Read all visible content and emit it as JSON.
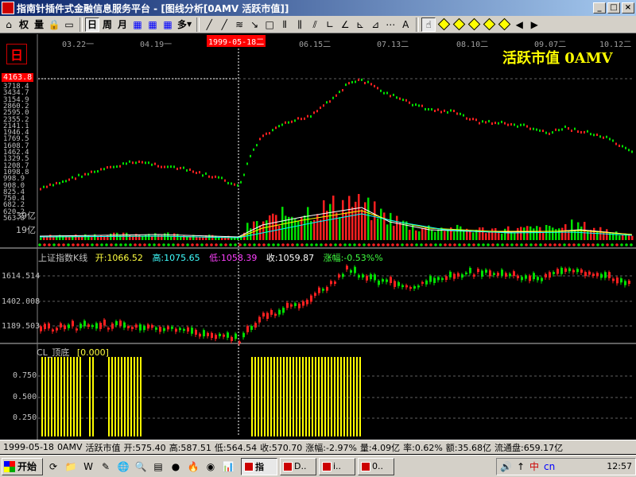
{
  "window": {
    "title": "指南针插件式金融信息服务平台 - [图线分析[0AMV 活跃市值]]",
    "buttons": [
      "_",
      "□",
      "×"
    ]
  },
  "toolbar": {
    "items": [
      {
        "id": "refresh",
        "label": "",
        "icon": "⌂"
      },
      {
        "id": "quan",
        "label": "权",
        "icon": ""
      },
      {
        "id": "liang",
        "label": "量",
        "icon": ""
      },
      {
        "id": "lock",
        "label": "",
        "icon": "🔒"
      },
      {
        "id": "window",
        "label": "",
        "icon": "▭"
      },
      {
        "id": "day",
        "label": "日",
        "icon": ""
      },
      {
        "id": "week",
        "label": "周",
        "icon": ""
      },
      {
        "id": "month",
        "label": "月",
        "icon": ""
      },
      {
        "id": "multi",
        "label": "多",
        "icon": ""
      }
    ],
    "draw_tools": [
      "╱",
      "╱",
      "≋",
      "↘",
      "□",
      "⫴",
      "⫼",
      "⫽",
      "∟",
      "∠",
      "⊾",
      "⊿",
      "⋯",
      "A"
    ],
    "pointer_icon": "☝"
  },
  "chart": {
    "period_label": "日",
    "title": "活跃市值 0AMV",
    "cursor_date": "1999-05-18二",
    "date_ticks": [
      "03.22一",
      "04.19一",
      "06.15二",
      "07.13二",
      "08.10二",
      "09.07二",
      "10.12二"
    ],
    "price_cursor": "4163.8",
    "price_labels": [
      "3718.4",
      "3434.7",
      "3154.9",
      "2860.2",
      "2595.0",
      "2355.2",
      "2141.1",
      "1946.4",
      "1769.5",
      "1608.7",
      "1462.4",
      "1329.5",
      "1208.7",
      "1098.8",
      "998.9",
      "908.0",
      "825.4",
      "750.4",
      "682.2",
      "620.2",
      "563.8"
    ],
    "volume_labels": [
      "39亿",
      "19亿"
    ],
    "colors": {
      "up": "#ff2020",
      "down": "#00e000",
      "ma1": "#ffffff",
      "ma2": "#ffff00",
      "ma3": "#00ffff",
      "indicator": "#ffff00"
    }
  },
  "index_panel": {
    "name": "上证指数K线",
    "open_label": "开:",
    "open": "1066.52",
    "high_label": "高:",
    "high": "1075.65",
    "low_label": "低:",
    "low": "1058.39",
    "close_label": "收:",
    "close": "1059.87",
    "change_label": "涨幅:",
    "change": "-0.53%%",
    "axis_labels": [
      "1614.514",
      "1402.008",
      "1189.503"
    ]
  },
  "indicator_panel": {
    "name": "CL_顶底",
    "value": "[0.000]",
    "axis_labels": [
      "0.750",
      "0.500",
      "0.250"
    ]
  },
  "statusline": {
    "date": "1999-05-18",
    "code": "0AMV",
    "name": "活跃市值",
    "open": "开:575.40",
    "high": "高:587.51",
    "low": "低:564.54",
    "close": "收:570.70",
    "change": "涨幅:-2.97%",
    "volume": "量:4.09亿",
    "rate": "率:0.62%",
    "amount": "额:35.68亿",
    "float": "流通盘:659.17亿"
  },
  "taskbar": {
    "start_label": "开始",
    "quick_launch": [
      "⟳",
      "📁",
      "W",
      "✎",
      "🌐",
      "🔍",
      "▤",
      "●",
      "🔥",
      "◉",
      "📊"
    ],
    "tasks": [
      {
        "label": "指",
        "active": true
      },
      {
        "label": "D..",
        "active": false
      },
      {
        "label": "i..",
        "active": false
      },
      {
        "label": "0..",
        "active": false
      }
    ],
    "tray_icons": [
      "🔊",
      "↑",
      "中",
      "cn"
    ],
    "clock": "12:57"
  }
}
